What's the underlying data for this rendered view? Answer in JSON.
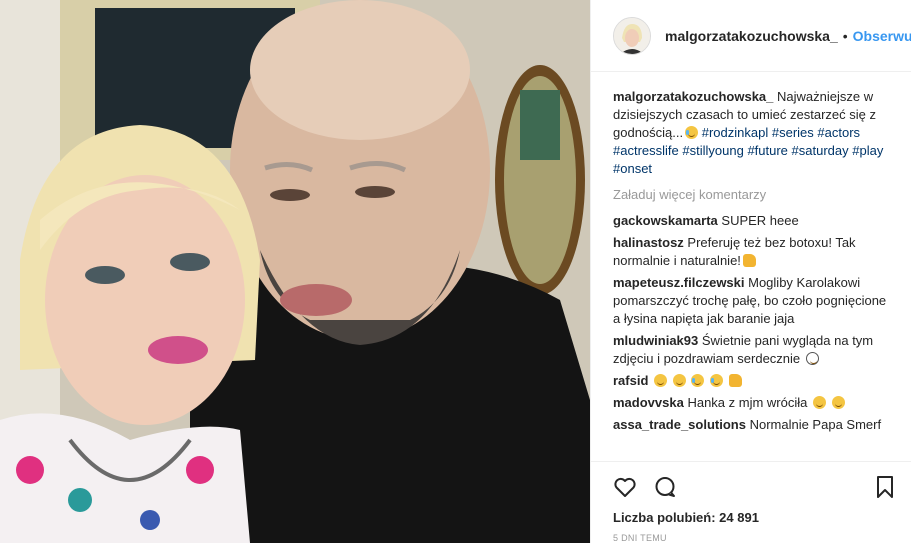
{
  "header": {
    "username": "malgorzatakozuchowska_",
    "separator": "•",
    "follow_label": "Obserwuj"
  },
  "caption": {
    "username": "malgorzatakozuchowska_",
    "text": "Najważniejsze w dzisiejszych czasach to umieć zestarzeć się z godnością...",
    "tags": [
      "#rodzinkapl",
      "#series",
      "#actors",
      "#actresslife",
      "#stillyoung",
      "#future",
      "#saturday",
      "#play",
      "#onset"
    ]
  },
  "load_more_label": "Załaduj więcej komentarzy",
  "comments": [
    {
      "user": "gackowskamarta",
      "text": "SUPER heee"
    },
    {
      "user": "halinastosz",
      "text": "Preferuję też bez botoxu! Tak normalnie i naturalnie!"
    },
    {
      "user": "mapeteusz.filczewski",
      "text": "Mogliby Karolakowi pomarszczyć trochę pałę, bo czoło pognięcione a łysina napięta jak baranie jaja"
    },
    {
      "user": "mludwiniak93",
      "text": "Świetnie pani wygląda na tym zdjęciu i pozdrawiam serdecznie"
    },
    {
      "user": "rafsid",
      "text": ""
    },
    {
      "user": "madovvska",
      "text": "Hanka z mjm wróciła"
    },
    {
      "user": "assa_trade_solutions",
      "text": "Normalnie Papa Smerf"
    }
  ],
  "likes_label": "Liczba polubień: 24 891",
  "time_label": "5 dni temu",
  "icons": {
    "like": "heart-icon",
    "comment": "comment-icon",
    "save": "bookmark-icon"
  }
}
